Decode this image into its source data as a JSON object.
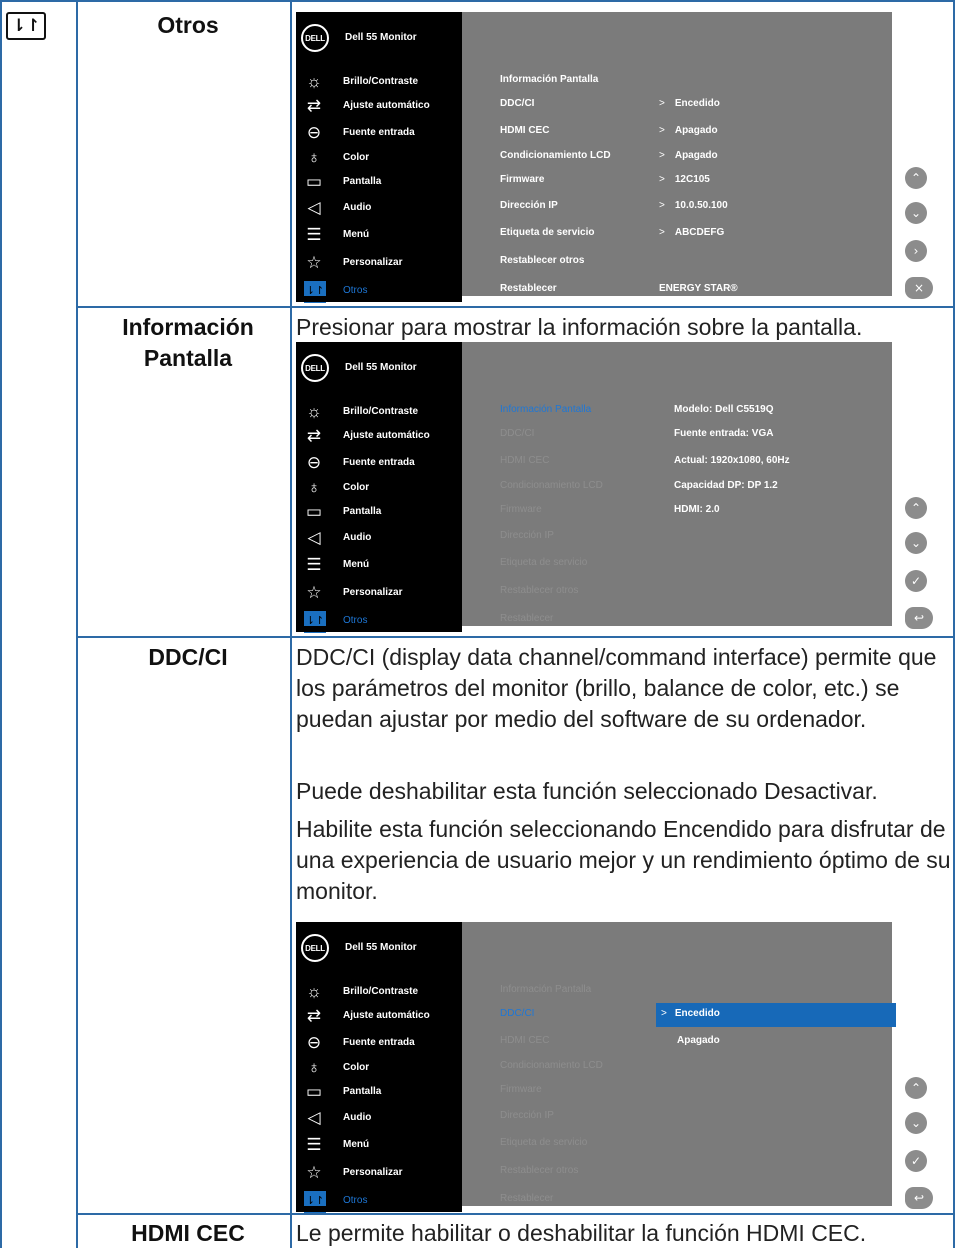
{
  "section_icon": "⇂↾",
  "osd_title": "Dell 55 Monitor",
  "logo_text": "DELL",
  "menu_items": [
    {
      "label": "Brillo/Contraste",
      "icon": "sun-icon"
    },
    {
      "label": "Ajuste automático",
      "icon": "arrows-icon"
    },
    {
      "label": "Fuente entrada",
      "icon": "input-source-icon"
    },
    {
      "label": "Color",
      "icon": "color-drop-icon"
    },
    {
      "label": "Pantalla",
      "icon": "display-icon"
    },
    {
      "label": "Audio",
      "icon": "speaker-icon"
    },
    {
      "label": "Menú",
      "icon": "menu-icon"
    },
    {
      "label": "Personalizar",
      "icon": "star-icon"
    },
    {
      "label": "Otros",
      "icon": "others-icon"
    }
  ],
  "submenu_items": [
    "Información Pantalla",
    "DDC/CI",
    "HDMI CEC",
    "Condicionamiento LCD",
    "Firmware",
    "Dirección IP",
    "Etiqueta de servicio",
    "Restablecer otros",
    "Restablecer"
  ],
  "rows": [
    {
      "label": "Otros",
      "osd": {
        "values": [
          ">  Encedido",
          ">  Apagado",
          ">  Apagado",
          ">  12C105",
          ">  10.0.50.100",
          ">  ABCDEFG"
        ],
        "energy_star": "ENERGY STAR®",
        "buttons": [
          "up-icon",
          "down-icon",
          "right-icon",
          "close-icon"
        ]
      }
    },
    {
      "label": "Información Pantalla",
      "text": "Presionar para mostrar la información sobre la pantalla.",
      "osd": {
        "info": [
          "Modelo: Dell C5519Q",
          "Fuente entrada: VGA",
          "Actual: 1920x1080, 60Hz",
          "Capacidad DP: DP 1.2",
          "HDMI: 2.0"
        ],
        "buttons": [
          "up-icon",
          "down-icon",
          "check-icon",
          "back-icon"
        ]
      }
    },
    {
      "label": "DDC/CI",
      "paragraphs": [
        "DDC/CI (display data channel/command interface) permite que los parámetros del monitor (brillo, balance de color, etc.) se puedan ajustar por medio del software de su ordenador.",
        "Puede deshabilitar esta función seleccionado Desactivar.",
        "Habilite esta función seleccionando Encendido para disfrutar de una experiencia de usuario mejor y un rendimiento óptimo de su monitor."
      ],
      "osd": {
        "options": [
          "Encedido",
          "Apagado"
        ],
        "buttons": [
          "up-icon",
          "down-icon",
          "check-icon",
          "back-icon"
        ]
      }
    },
    {
      "label": "HDMI CEC",
      "text": "Le permite habilitar o deshabilitar la función HDMI CEC."
    }
  ]
}
